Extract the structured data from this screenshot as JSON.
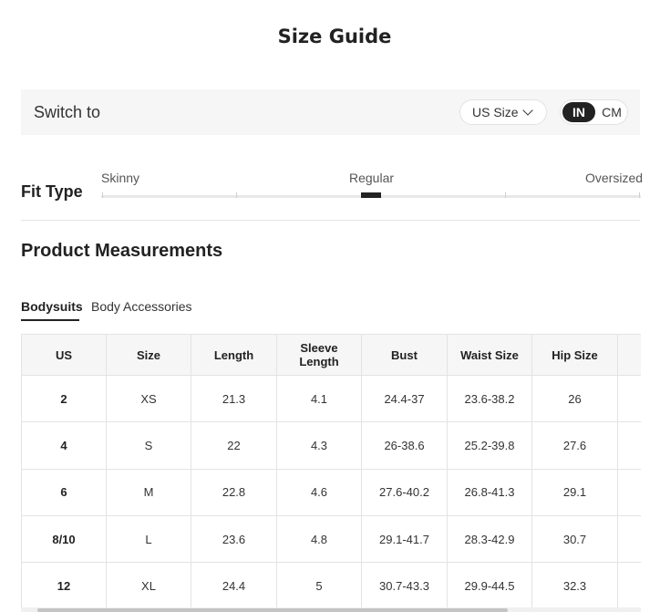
{
  "title": "Size Guide",
  "switch": {
    "label": "Switch to",
    "size_system": "US Size",
    "unit_in": "IN",
    "unit_cm": "CM",
    "selected_unit": "IN"
  },
  "fit": {
    "label": "Fit Type",
    "options": [
      "Skinny",
      "Regular",
      "Oversized"
    ],
    "selected": "Regular"
  },
  "section_title": "Product Measurements",
  "tabs": [
    {
      "label": "Bodysuits",
      "active": true
    },
    {
      "label": "Body Accessories",
      "active": false
    }
  ],
  "table": {
    "headers": [
      "US",
      "Size",
      "Length",
      "Sleeve Length",
      "Bust",
      "Waist Size",
      "Hip Size"
    ],
    "rows": [
      [
        "2",
        "XS",
        "21.3",
        "4.1",
        "24.4-37",
        "23.6-38.2",
        "26"
      ],
      [
        "4",
        "S",
        "22",
        "4.3",
        "26-38.6",
        "25.2-39.8",
        "27.6"
      ],
      [
        "6",
        "M",
        "22.8",
        "4.6",
        "27.6-40.2",
        "26.8-41.3",
        "29.1"
      ],
      [
        "8/10",
        "L",
        "23.6",
        "4.8",
        "29.1-41.7",
        "28.3-42.9",
        "30.7"
      ],
      [
        "12",
        "XL",
        "24.4",
        "5",
        "30.7-43.3",
        "29.9-44.5",
        "32.3"
      ]
    ]
  }
}
